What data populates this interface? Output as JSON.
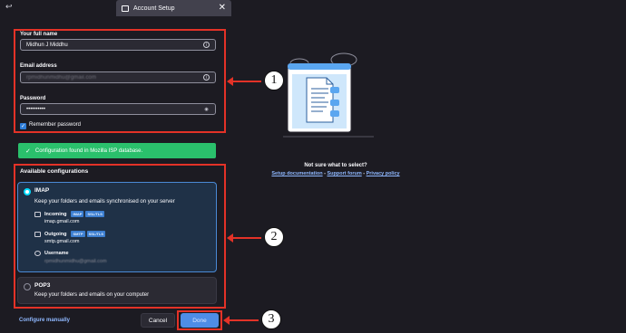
{
  "window": {
    "tab_title": "Account Setup",
    "close_glyph": "✕",
    "top_left_glyph": "↩"
  },
  "form": {
    "name_label": "Your full name",
    "name_value": "Midhun J Middhu",
    "email_label": "Email address",
    "email_value": "rpmidhunmidhu@gmail.com",
    "password_label": "Password",
    "password_value": "••••••••••",
    "remember_label": "Remember password"
  },
  "banner": {
    "text": "Configuration found in Mozilla ISP database.",
    "icon": "check-icon",
    "color": "#2ac06c"
  },
  "configs": {
    "heading": "Available configurations",
    "imap": {
      "title": "IMAP",
      "desc": "Keep your folders and emails synchronised on your server",
      "incoming_label": "Incoming",
      "incoming_badges": [
        "IMAP",
        "SSL/TLS"
      ],
      "incoming_host": "imap.gmail.com",
      "outgoing_label": "Outgoing",
      "outgoing_badges": [
        "SMTP",
        "SSL/TLS"
      ],
      "outgoing_host": "smtp.gmail.com",
      "username_label": "Username",
      "username_value": "rpmidhunmidhu@gmail.com"
    },
    "pop3": {
      "title": "POP3",
      "desc": "Keep your folders and emails on your computer"
    }
  },
  "footer": {
    "configure_manually": "Configure manually",
    "cancel": "Cancel",
    "done": "Done"
  },
  "help": {
    "question": "Not sure what to select?",
    "links": [
      "Setup documentation",
      "Support forum",
      "Privacy policy"
    ],
    "separator": " - "
  },
  "annotations": {
    "callout_1": "1",
    "callout_2": "2",
    "callout_3": "3",
    "color": "#e33227"
  }
}
